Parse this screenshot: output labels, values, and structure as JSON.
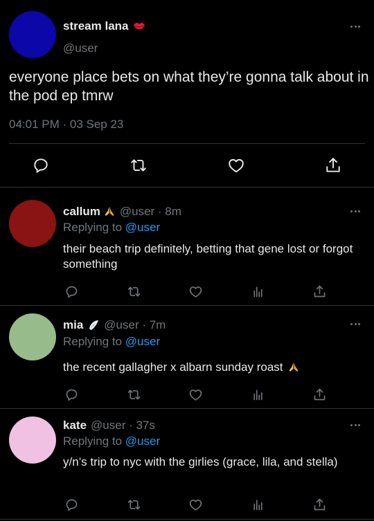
{
  "colors": {
    "background": "#000000",
    "text": "#e7e9ea",
    "muted": "#71767b",
    "link": "#1d9bf0",
    "divider": "#2f3336"
  },
  "main_tweet": {
    "avatar_color": "#0b07a8",
    "name": "stream lana",
    "name_emoji": "lips-icon",
    "handle": "@user",
    "text": "everyone place bets on what they’re gonna talk about in the pod ep tmrw",
    "timestamp": "04:01 PM · 03 Sep 23",
    "actions": [
      "reply-icon",
      "retweet-icon",
      "like-icon",
      "share-icon"
    ]
  },
  "replies": [
    {
      "avatar_color": "#8a1313",
      "name": "callum",
      "emoji": "folded-hands-icon",
      "meta": "@user · 8m",
      "replying_prefix": "Replying to",
      "replying_mention": "@user",
      "text": "their beach trip definitely, betting that gene lost or forgot something"
    },
    {
      "avatar_color": "#98bb8c",
      "name": "mia",
      "emoji": "wing-icon",
      "meta": "@user · 7m",
      "replying_prefix": "Replying to",
      "replying_mention": "@user",
      "text": "the recent gallagher x albarn sunday roast",
      "text_emoji": "folded-hands-icon"
    },
    {
      "avatar_color": "#f0c1e2",
      "name": "kate",
      "meta": "@user · 37s",
      "replying_prefix": "Replying to",
      "replying_mention": "@user",
      "text": "y/n’s trip to nyc with the girlies (grace, lila, and stella)"
    }
  ]
}
